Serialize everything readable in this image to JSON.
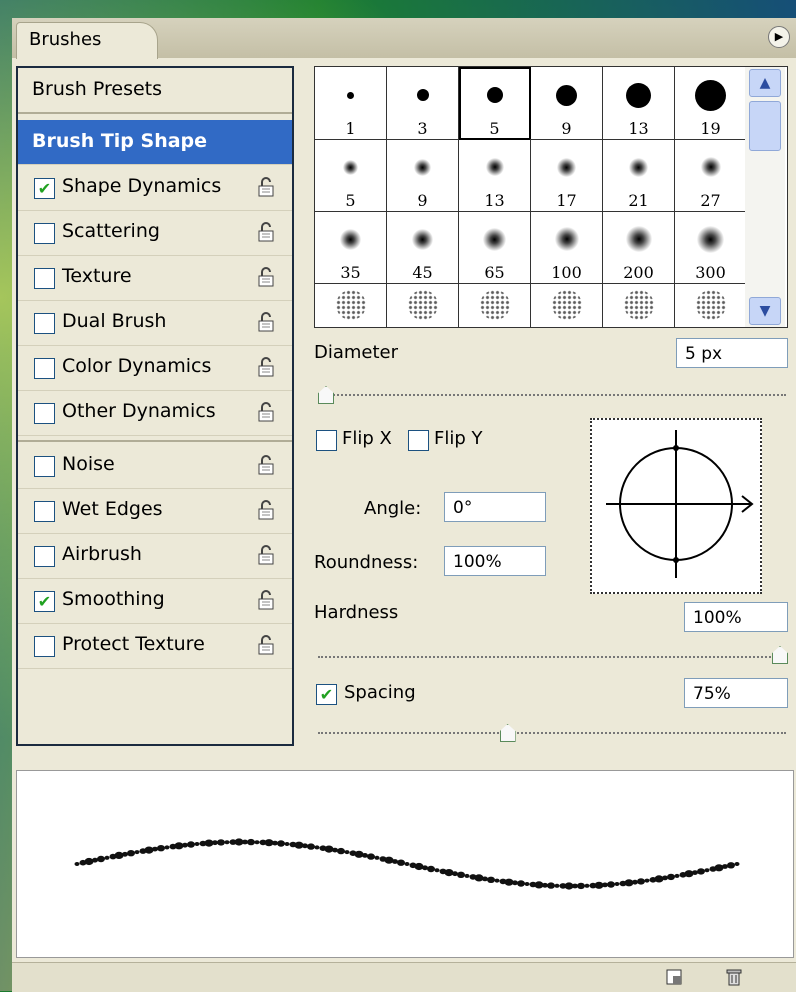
{
  "panel": {
    "tab_label": "Brushes",
    "menu_icon": "panel-menu-icon"
  },
  "left_list": {
    "presets": "Brush Presets",
    "tip_shape": "Brush Tip Shape",
    "options": [
      {
        "label": "Shape Dynamics",
        "checked": true
      },
      {
        "label": "Scattering",
        "checked": false
      },
      {
        "label": "Texture",
        "checked": false
      },
      {
        "label": "Dual Brush",
        "checked": false
      },
      {
        "label": "Color Dynamics",
        "checked": false
      },
      {
        "label": "Other Dynamics",
        "checked": false
      },
      {
        "label": "Noise",
        "checked": false
      },
      {
        "label": "Wet Edges",
        "checked": false
      },
      {
        "label": "Airbrush",
        "checked": false
      },
      {
        "label": "Smoothing",
        "checked": true
      },
      {
        "label": "Protect Texture",
        "checked": false
      }
    ]
  },
  "brush_grid": {
    "rows": [
      [
        {
          "size": "1",
          "kind": "hard"
        },
        {
          "size": "3",
          "kind": "hard"
        },
        {
          "size": "5",
          "kind": "hard",
          "selected": true
        },
        {
          "size": "9",
          "kind": "hard"
        },
        {
          "size": "13",
          "kind": "hard"
        },
        {
          "size": "19",
          "kind": "hard"
        }
      ],
      [
        {
          "size": "5",
          "kind": "soft"
        },
        {
          "size": "9",
          "kind": "soft"
        },
        {
          "size": "13",
          "kind": "soft"
        },
        {
          "size": "17",
          "kind": "soft"
        },
        {
          "size": "21",
          "kind": "soft"
        },
        {
          "size": "27",
          "kind": "soft"
        }
      ],
      [
        {
          "size": "35",
          "kind": "soft"
        },
        {
          "size": "45",
          "kind": "soft"
        },
        {
          "size": "65",
          "kind": "soft"
        },
        {
          "size": "100",
          "kind": "soft"
        },
        {
          "size": "200",
          "kind": "soft"
        },
        {
          "size": "300",
          "kind": "soft"
        }
      ],
      [
        {
          "size": "",
          "kind": "spatter"
        },
        {
          "size": "",
          "kind": "spatter"
        },
        {
          "size": "",
          "kind": "spatter"
        },
        {
          "size": "",
          "kind": "spatter"
        },
        {
          "size": "",
          "kind": "spatter"
        },
        {
          "size": "",
          "kind": "spatter"
        }
      ]
    ]
  },
  "tip": {
    "diameter_label": "Diameter",
    "diameter_value": "5 px",
    "flip_x": "Flip X",
    "flip_y": "Flip Y",
    "angle_label": "Angle:",
    "angle_value": "0°",
    "roundness_label": "Roundness:",
    "roundness_value": "100%",
    "hardness_label": "Hardness",
    "hardness_value": "100%",
    "spacing_label": "Spacing",
    "spacing_value": "75%",
    "spacing_checked": true
  },
  "sliders": {
    "diameter_level": 0.0,
    "hardness_level": 1.0,
    "spacing_level": 0.4
  },
  "colors": {
    "selection": "#316ac5",
    "check": "#21a121"
  }
}
